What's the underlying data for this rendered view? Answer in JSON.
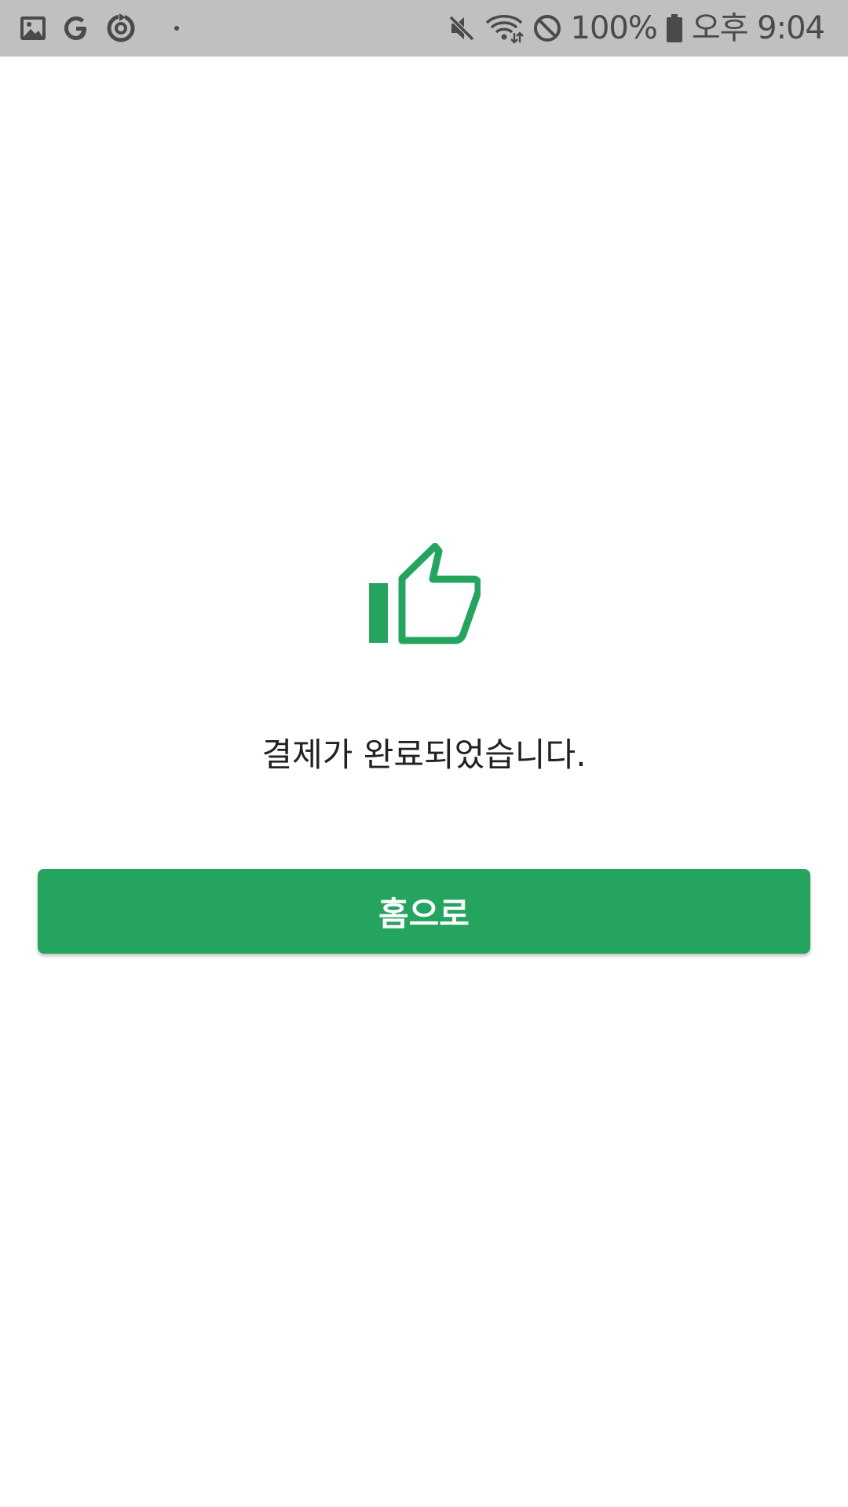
{
  "status_bar": {
    "battery": "100%",
    "time": "오후 9:04",
    "icons": [
      "gallery-icon",
      "google-icon",
      "sync-icon",
      "notification-dot",
      "mute-icon",
      "wifi-icon",
      "block-icon",
      "battery-icon"
    ]
  },
  "main": {
    "icon": "thumbs-up-icon",
    "message": "결제가 완료되었습니다.",
    "home_button_label": "홈으로"
  },
  "colors": {
    "accent": "#24a45e",
    "status_bar_bg": "#c0c0c0",
    "status_icon": "#4a4a4a",
    "text": "#222222"
  }
}
